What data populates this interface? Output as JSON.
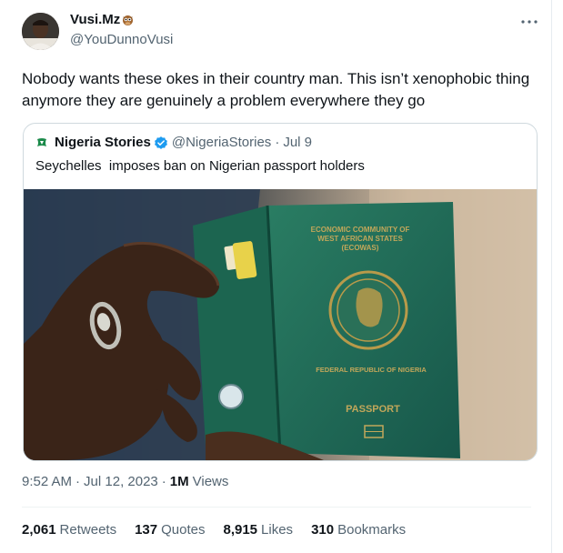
{
  "author": {
    "name": "Vusi.Mz",
    "handle": "@YouDunnoVusi",
    "emoji_icon": "owl-icon"
  },
  "more_icon": "more-horizontal-icon",
  "tweet": {
    "text": "Nobody wants these okes in their country man. This isn’t xenophobic thing anymore they are genuinely a problem everywhere they go"
  },
  "quote": {
    "name": "Nigeria Stories",
    "handle": "@NigeriaStories",
    "separator": "·",
    "date": "Jul 9",
    "text": "Seychelles  imposes ban on Nigerian passport holders",
    "passport": {
      "line1": "ECONOMIC COMMUNITY OF",
      "line2": "WEST AFRICAN STATES",
      "line3": "(ECOWAS)",
      "republic": "FEDERAL REPUBLIC OF NIGERIA",
      "passport_word": "PASSPORT"
    }
  },
  "meta": {
    "time": "9:52 AM",
    "sep1": "·",
    "date": "Jul 12, 2023",
    "sep2": "·",
    "views_count": "1M",
    "views_label": "Views"
  },
  "stats": [
    {
      "count": "2,061",
      "label": "Retweets"
    },
    {
      "count": "137",
      "label": "Quotes"
    },
    {
      "count": "8,915",
      "label": "Likes"
    },
    {
      "count": "310",
      "label": "Bookmarks"
    }
  ],
  "colors": {
    "text": "#0f1419",
    "secondary": "#536471",
    "border": "#cfd9de",
    "verified": "#1d9bf0",
    "passport_green": "#1f6e58"
  }
}
